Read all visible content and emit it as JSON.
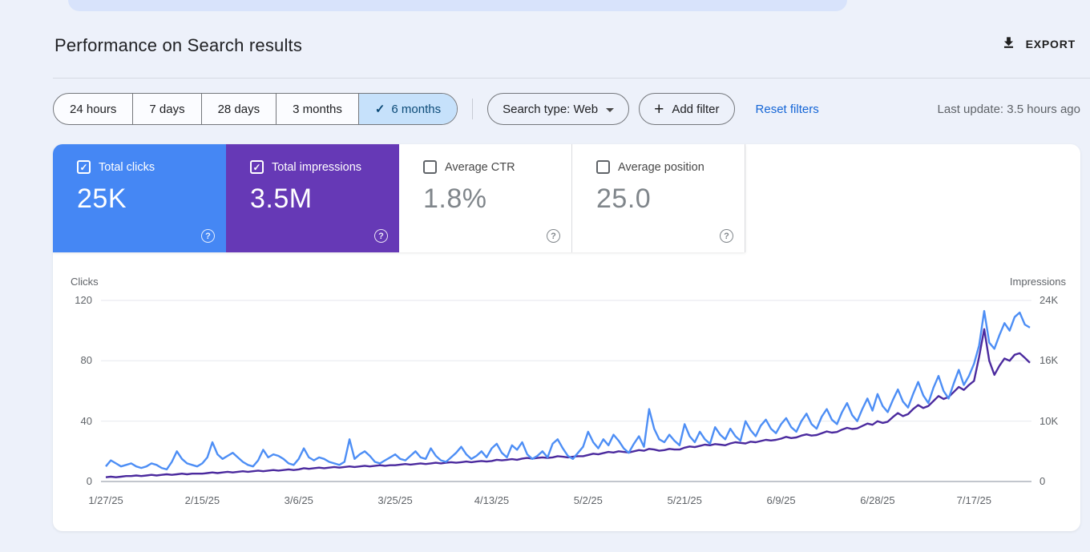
{
  "header": {
    "title": "Performance on Search results",
    "export_label": "EXPORT"
  },
  "filters": {
    "date_ranges": [
      {
        "label": "24 hours",
        "selected": false
      },
      {
        "label": "7 days",
        "selected": false
      },
      {
        "label": "28 days",
        "selected": false
      },
      {
        "label": "3 months",
        "selected": false
      },
      {
        "label": "6 months",
        "selected": true
      }
    ],
    "search_type_label": "Search type: Web",
    "add_filter_label": "Add filter",
    "reset_label": "Reset filters",
    "last_update": "Last update: 3.5 hours ago"
  },
  "metrics": {
    "cards": [
      {
        "label": "Total clicks",
        "value": "25K",
        "checked": true,
        "color": "#4587f4"
      },
      {
        "label": "Total impressions",
        "value": "3.5M",
        "checked": true,
        "color": "#6639b6"
      },
      {
        "label": "Average CTR",
        "value": "1.8%",
        "checked": false,
        "color": "#ffffff"
      },
      {
        "label": "Average position",
        "value": "25.0",
        "checked": false,
        "color": "#ffffff"
      }
    ]
  },
  "chart_data": {
    "type": "line",
    "grid": "horizontal",
    "left_axis": {
      "label": "Clicks",
      "ticks": [
        0,
        40,
        80,
        120
      ],
      "tick_labels": [
        "0",
        "40",
        "80",
        "120"
      ]
    },
    "right_axis": {
      "label": "Impressions",
      "ticks_k": [
        0,
        10,
        16,
        24
      ],
      "tick_labels": [
        "0",
        "10K",
        "16K",
        "24K"
      ]
    },
    "x_labels": [
      "1/27/25",
      "2/15/25",
      "3/6/25",
      "3/25/25",
      "4/13/25",
      "5/2/25",
      "5/21/25",
      "6/9/25",
      "6/28/25",
      "7/17/25"
    ],
    "x_label_interval_days": 19,
    "total_days": 183,
    "series": [
      {
        "name": "Clicks",
        "axis": "left",
        "color": "#4d8ef5",
        "values": [
          10,
          14,
          12,
          10,
          11,
          12,
          10,
          9,
          10,
          12,
          11,
          9,
          8,
          13,
          20,
          15,
          12,
          11,
          10,
          12,
          16,
          26,
          18,
          15,
          17,
          19,
          16,
          13,
          11,
          10,
          14,
          21,
          16,
          18,
          17,
          15,
          12,
          11,
          15,
          22,
          16,
          14,
          16,
          15,
          13,
          12,
          11,
          13,
          28,
          15,
          18,
          20,
          17,
          13,
          12,
          14,
          16,
          18,
          15,
          14,
          17,
          20,
          16,
          15,
          22,
          17,
          14,
          13,
          16,
          19,
          23,
          18,
          15,
          17,
          20,
          16,
          22,
          25,
          19,
          16,
          24,
          21,
          26,
          18,
          15,
          17,
          20,
          16,
          25,
          28,
          22,
          17,
          15,
          19,
          23,
          33,
          26,
          22,
          28,
          24,
          31,
          27,
          22,
          19,
          25,
          30,
          23,
          48,
          35,
          28,
          26,
          31,
          27,
          24,
          38,
          30,
          26,
          33,
          28,
          25,
          36,
          31,
          28,
          35,
          30,
          27,
          40,
          34,
          30,
          37,
          41,
          35,
          32,
          38,
          42,
          36,
          33,
          40,
          45,
          38,
          35,
          43,
          48,
          41,
          38,
          46,
          52,
          44,
          40,
          48,
          55,
          47,
          58,
          50,
          46,
          54,
          61,
          53,
          49,
          58,
          66,
          57,
          52,
          62,
          70,
          60,
          55,
          65,
          74,
          64,
          70,
          78,
          90,
          113,
          92,
          88,
          97,
          105,
          100,
          109,
          112,
          104,
          102
        ]
      },
      {
        "name": "Impressions",
        "axis": "right",
        "unit": "K",
        "color": "#4b2a9e",
        "values": [
          0.7,
          0.8,
          0.7,
          0.8,
          0.9,
          0.9,
          1.0,
          0.9,
          1.0,
          1.1,
          1.0,
          1.1,
          1.2,
          1.1,
          1.2,
          1.3,
          1.2,
          1.3,
          1.3,
          1.3,
          1.4,
          1.5,
          1.4,
          1.5,
          1.6,
          1.5,
          1.6,
          1.7,
          1.6,
          1.7,
          1.8,
          1.7,
          1.8,
          1.9,
          1.8,
          1.9,
          2.0,
          1.9,
          2.0,
          2.2,
          2.1,
          2.2,
          2.3,
          2.2,
          2.3,
          2.4,
          2.3,
          2.4,
          2.5,
          2.4,
          2.5,
          2.6,
          2.5,
          2.6,
          2.7,
          2.6,
          2.7,
          2.7,
          2.8,
          2.9,
          2.8,
          2.9,
          3.0,
          2.9,
          3.0,
          3.1,
          3.0,
          3.1,
          3.2,
          3.1,
          3.2,
          3.3,
          3.2,
          3.3,
          3.4,
          3.3,
          3.4,
          3.6,
          3.5,
          3.6,
          3.7,
          3.6,
          3.8,
          3.9,
          3.8,
          3.9,
          4.0,
          3.9,
          4.0,
          4.2,
          4.1,
          4.0,
          4.1,
          4.2,
          4.2,
          4.4,
          4.6,
          4.5,
          4.7,
          4.9,
          4.8,
          5.0,
          4.9,
          4.8,
          5.0,
          5.2,
          5.1,
          5.4,
          5.3,
          5.1,
          5.2,
          5.4,
          5.3,
          5.3,
          5.6,
          5.8,
          5.7,
          5.9,
          6.1,
          6.0,
          6.2,
          6.1,
          6.0,
          6.3,
          6.5,
          6.4,
          6.3,
          6.6,
          6.5,
          6.7,
          6.9,
          6.8,
          6.9,
          7.1,
          7.4,
          7.2,
          7.3,
          7.6,
          7.8,
          7.6,
          7.7,
          8.0,
          8.3,
          8.1,
          8.2,
          8.6,
          8.9,
          8.7,
          8.8,
          9.2,
          9.6,
          9.4,
          10.0,
          9.7,
          9.9,
          10.4,
          10.8,
          10.5,
          10.7,
          11.2,
          11.6,
          11.3,
          11.5,
          12.0,
          12.5,
          12.2,
          12.4,
          12.9,
          13.4,
          13.1,
          13.6,
          14.0,
          16.5,
          20.2,
          16.0,
          14.6,
          15.5,
          16.3,
          16.0,
          16.8,
          17.0,
          16.4,
          15.8
        ]
      }
    ]
  }
}
